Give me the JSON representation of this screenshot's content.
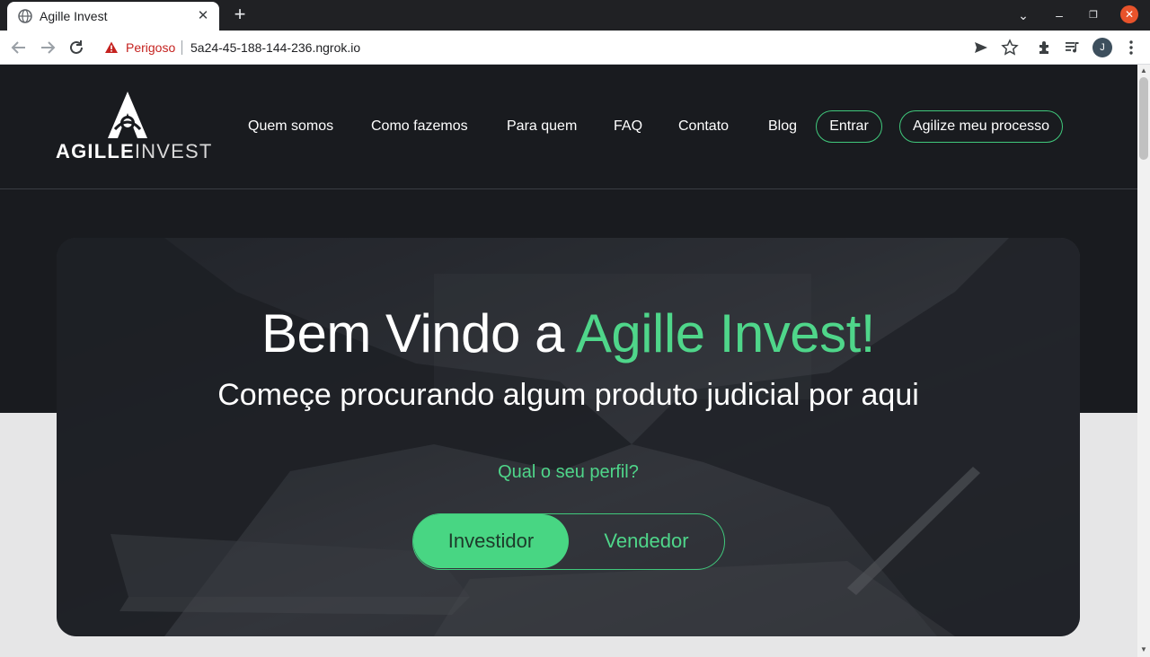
{
  "browser": {
    "tab_title": "Agille Invest",
    "tab_close": "✕",
    "new_tab": "+",
    "security_label": "Perigoso",
    "url": "5a24-45-188-144-236.ngrok.io",
    "avatar_initial": "J",
    "window_controls": {
      "chevron": "⌄",
      "minimize": "–",
      "restore": "❐",
      "close": "✕"
    },
    "icons": [
      "back-icon",
      "forward-icon",
      "reload-icon",
      "warning-icon",
      "send-icon",
      "star-icon",
      "extensions-icon",
      "media-icon",
      "menu-icon"
    ]
  },
  "header": {
    "logo": {
      "bold": "AGILLE",
      "light": "INVEST"
    },
    "nav": [
      {
        "label": "Quem somos"
      },
      {
        "label": "Como fazemos"
      },
      {
        "label": "Para quem"
      },
      {
        "label": "FAQ"
      },
      {
        "label": "Contato"
      },
      {
        "label": "Blog"
      }
    ],
    "login_label": "Entrar",
    "cta_label": "Agilize meu processo"
  },
  "hero": {
    "title_prefix": "Bem Vindo a ",
    "title_accent": "Agille Invest!",
    "subtitle": "Começe procurando algum produto judicial por aqui",
    "question": "Qual o seu perfil?",
    "options": [
      {
        "label": "Investidor",
        "selected": true
      },
      {
        "label": "Vendedor",
        "selected": false
      }
    ]
  },
  "colors": {
    "accent": "#4fd68a",
    "dark": "#191b1f",
    "light_bg": "#e6e6e7",
    "danger": "#c5221f",
    "close_button": "#e8532b"
  }
}
